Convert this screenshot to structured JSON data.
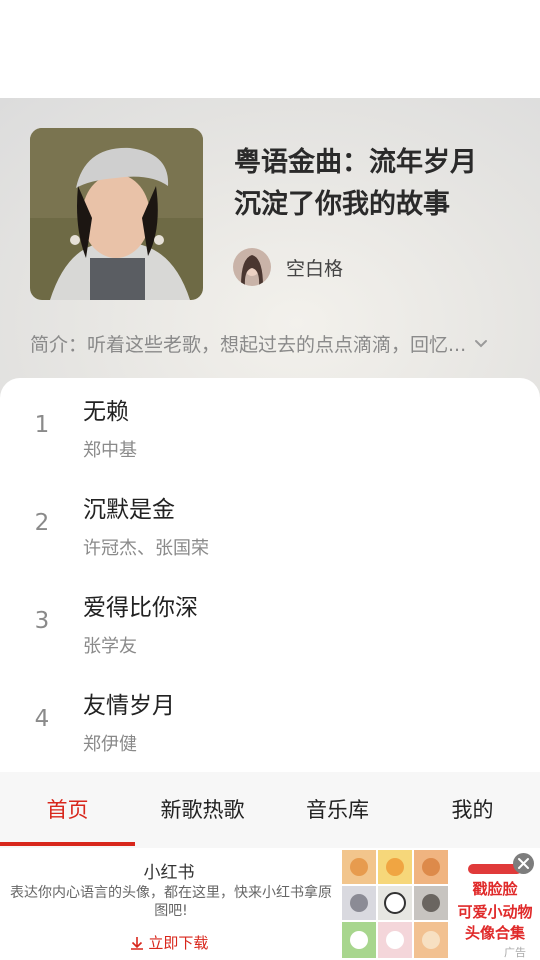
{
  "playlist": {
    "title_line1": "粤语金曲：流年岁月",
    "title_line2": "沉淀了你我的故事",
    "creator_name": "空白格",
    "intro": "简介：听着这些老歌，想起过去的点点滴滴，回忆..."
  },
  "songs": [
    {
      "index": "1",
      "title": "无赖",
      "artist": "郑中基"
    },
    {
      "index": "2",
      "title": "沉默是金",
      "artist": "许冠杰、张国荣"
    },
    {
      "index": "3",
      "title": "爱得比你深",
      "artist": "张学友"
    },
    {
      "index": "4",
      "title": "友情岁月",
      "artist": "郑伊健"
    }
  ],
  "tabs": [
    {
      "label": "首页",
      "active": true
    },
    {
      "label": "新歌热歌"
    },
    {
      "label": "音乐库"
    },
    {
      "label": "我的"
    }
  ],
  "ad": {
    "brand": "小红书",
    "description": "表达你内心语言的头像，都在这里，快来小红书拿原图吧!",
    "cta": "立即下载",
    "image_line1": "戳脸脸",
    "image_line2": "可爱小动物",
    "image_line3": "头像合集",
    "label": "广告"
  },
  "colors": {
    "accent": "#d8271c",
    "header_bg": "#e6e5e2",
    "secondary_text": "#8a8a8a"
  },
  "icons": {
    "intro_expand": "chevron-down-icon",
    "ad_close": "close-icon",
    "ad_download": "download-arrow-icon"
  }
}
